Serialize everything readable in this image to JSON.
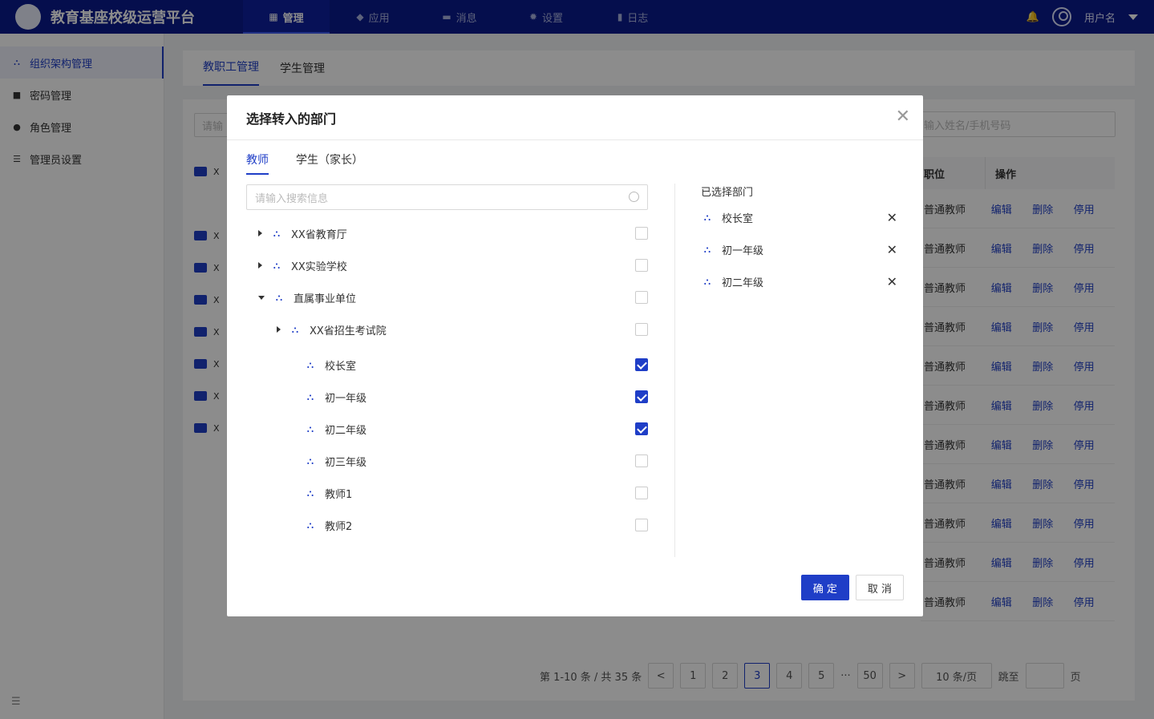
{
  "app": {
    "title": "教育基座校级运营平台"
  },
  "nav": {
    "items": [
      {
        "label": "管理",
        "icon": "grid-icon",
        "active": true
      },
      {
        "label": "应用",
        "icon": "cube-icon"
      },
      {
        "label": "消息",
        "icon": "message-icon"
      },
      {
        "label": "设置",
        "icon": "gear-icon"
      },
      {
        "label": "日志",
        "icon": "book-icon"
      }
    ],
    "username": "用户名"
  },
  "sidebar": {
    "items": [
      {
        "label": "组织架构管理",
        "icon": "org-icon",
        "active": true
      },
      {
        "label": "密码管理",
        "icon": "lock-icon"
      },
      {
        "label": "角色管理",
        "icon": "users-icon"
      },
      {
        "label": "管理员设置",
        "icon": "admin-icon"
      }
    ]
  },
  "page": {
    "tabs": [
      {
        "label": "教职工管理",
        "active": true
      },
      {
        "label": "学生管理"
      }
    ],
    "search_left_placeholder": "请输",
    "search_right_placeholder": "输入姓名/手机号码",
    "tree_left_rows": [
      "X",
      "X",
      "X",
      "X",
      "X",
      "X",
      "X",
      "X"
    ],
    "table": {
      "headers": {
        "role": "职位",
        "op": "操作"
      },
      "role_value": "普通教师",
      "actions": [
        "编辑",
        "删除",
        "停用"
      ],
      "rows": 11
    },
    "pagination": {
      "summary": "第 1-10 条 / 共 35 条",
      "pages": [
        "1",
        "2",
        "3",
        "4",
        "5",
        "···",
        "50"
      ],
      "current": "3",
      "page_size": "10 条/页",
      "jump_label": "跳至",
      "page_unit": "页"
    }
  },
  "modal": {
    "title": "选择转入的部门",
    "tabs": [
      {
        "label": "教师",
        "active": true
      },
      {
        "label": "学生（家长）"
      }
    ],
    "search_placeholder": "请输入搜索信息",
    "tree": [
      {
        "label": "XX省教育厅",
        "level": 0,
        "expander": "right",
        "checked": false
      },
      {
        "label": "XX实验学校",
        "level": 0,
        "expander": "right",
        "checked": false
      },
      {
        "label": "直属事业单位",
        "level": 0,
        "expander": "down",
        "checked": false
      },
      {
        "label": "XX省招生考试院",
        "level": 1,
        "expander": "right",
        "checked": false
      },
      {
        "label": "校长室",
        "level": 2,
        "expander": "none",
        "checked": true
      },
      {
        "label": "初一年级",
        "level": 2,
        "expander": "none",
        "checked": true
      },
      {
        "label": "初二年级",
        "level": 2,
        "expander": "none",
        "checked": true
      },
      {
        "label": "初三年级",
        "level": 2,
        "expander": "none",
        "checked": false
      },
      {
        "label": "教师1",
        "level": 2,
        "expander": "none",
        "checked": false
      },
      {
        "label": "教师2",
        "level": 2,
        "expander": "none",
        "checked": false
      }
    ],
    "selected_title": "已选择部门",
    "selected": [
      "校长室",
      "初一年级",
      "初二年级"
    ],
    "confirm_label": "确 定",
    "cancel_label": "取 消"
  }
}
